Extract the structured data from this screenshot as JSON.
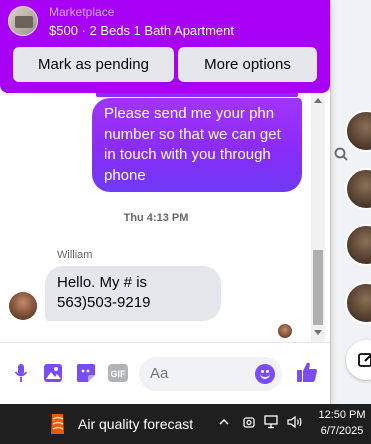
{
  "header": {
    "marketplace_label": "Marketplace",
    "listing_title": "$500 · 2 Beds 1 Bath Apartment",
    "mark_pending_label": "Mark as pending",
    "more_options_label": "More options",
    "accent_color": "#a800f5"
  },
  "messages": {
    "outgoing": {
      "lines": [
        "Please send me your phn",
        "number so that we can get",
        "in touch with you through",
        "phone"
      ]
    },
    "timestamp": "Thu 4:13 PM",
    "incoming": {
      "sender": "William",
      "lines": [
        "Hello. My # is",
        "563)503-9219"
      ]
    }
  },
  "composer": {
    "placeholder": "Aa",
    "icons": [
      "microphone-icon",
      "photo-icon",
      "sticker-icon",
      "gif-icon",
      "emoji-icon",
      "thumbs-up-icon"
    ],
    "gif_label": "GIF"
  },
  "taskbar": {
    "weather_text": "Air quality forecast",
    "time": "12:50 PM",
    "date": "6/7/2025"
  }
}
